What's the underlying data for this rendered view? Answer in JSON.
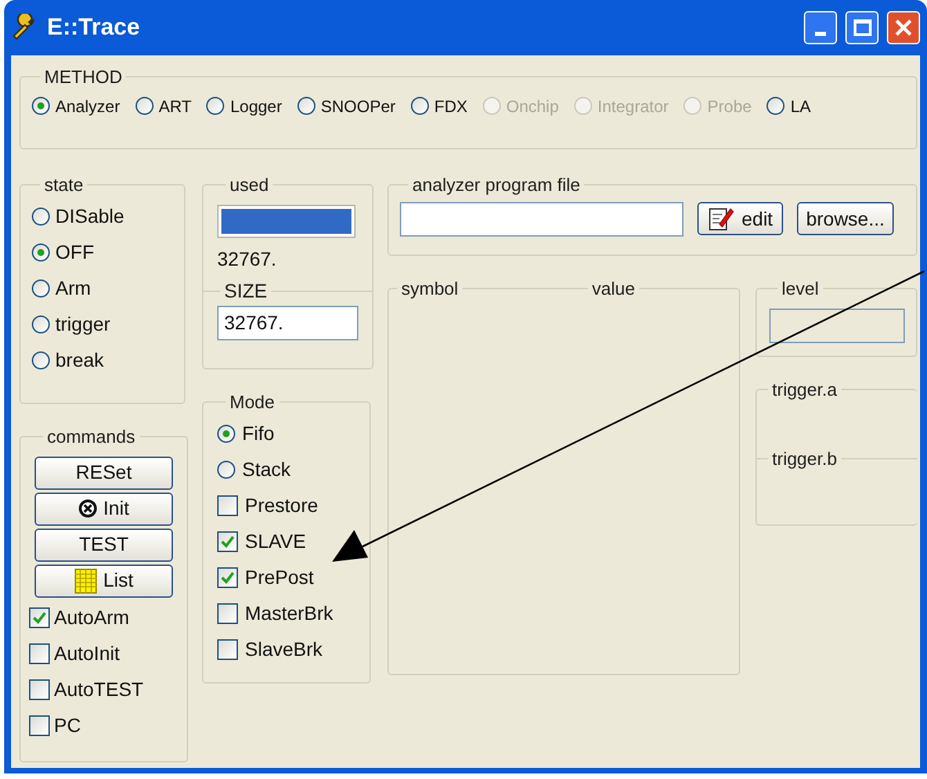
{
  "window": {
    "title": "E::Trace"
  },
  "method": {
    "label": "METHOD",
    "options": [
      {
        "label": "Analyzer",
        "selected": true,
        "disabled": false
      },
      {
        "label": "ART",
        "selected": false,
        "disabled": false
      },
      {
        "label": "Logger",
        "selected": false,
        "disabled": false
      },
      {
        "label": "SNOOPer",
        "selected": false,
        "disabled": false
      },
      {
        "label": "FDX",
        "selected": false,
        "disabled": false
      },
      {
        "label": "Onchip",
        "selected": false,
        "disabled": true
      },
      {
        "label": "Integrator",
        "selected": false,
        "disabled": true
      },
      {
        "label": "Probe",
        "selected": false,
        "disabled": true
      },
      {
        "label": "LA",
        "selected": false,
        "disabled": false
      }
    ]
  },
  "state": {
    "label": "state",
    "options": [
      {
        "label": "DISable",
        "selected": false
      },
      {
        "label": "OFF",
        "selected": true
      },
      {
        "label": "Arm",
        "selected": false
      },
      {
        "label": "trigger",
        "selected": false
      },
      {
        "label": "break",
        "selected": false
      }
    ]
  },
  "used": {
    "label": "used",
    "level": 1,
    "reading": "32767."
  },
  "size": {
    "label": "SIZE",
    "value": "32767."
  },
  "commands": {
    "label": "commands",
    "buttons": [
      {
        "label": "RESet",
        "kind": "plain"
      },
      {
        "label": "Init",
        "kind": "init"
      },
      {
        "label": "TEST",
        "kind": "plain"
      },
      {
        "label": "List",
        "kind": "list"
      }
    ],
    "checks": [
      {
        "label": "AutoArm",
        "checked": true
      },
      {
        "label": "AutoInit",
        "checked": false
      },
      {
        "label": "AutoTEST",
        "checked": false
      },
      {
        "label": "PC",
        "checked": false
      }
    ]
  },
  "mode": {
    "label": "Mode",
    "items": [
      {
        "kind": "radio",
        "label": "Fifo",
        "selected": true
      },
      {
        "kind": "radio",
        "label": "Stack",
        "selected": false
      },
      {
        "kind": "checkbox",
        "label": "Prestore",
        "checked": false
      },
      {
        "kind": "checkbox",
        "label": "SLAVE",
        "checked": true
      },
      {
        "kind": "checkbox",
        "label": "PrePost",
        "checked": true
      },
      {
        "kind": "checkbox",
        "label": "MasterBrk",
        "checked": false
      },
      {
        "kind": "checkbox",
        "label": "SlaveBrk",
        "checked": false
      }
    ]
  },
  "program_file": {
    "label": "analyzer program file",
    "buttons": [
      {
        "label": "edit",
        "kind": "edit"
      },
      {
        "label": "browse...",
        "kind": "plain"
      }
    ]
  },
  "symbols": {
    "columns": [
      "symbol",
      "value"
    ]
  },
  "level": {
    "label": "level"
  },
  "trigger": {
    "labels": [
      "trigger.a",
      "trigger.b"
    ]
  }
}
